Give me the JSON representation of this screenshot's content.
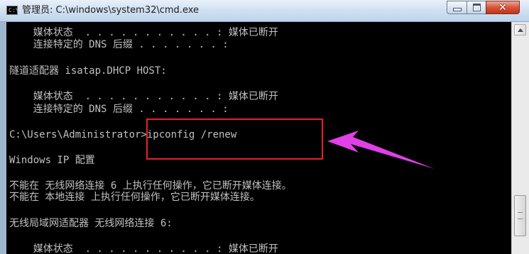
{
  "window": {
    "title": "管理员: C:\\windows\\system32\\cmd.exe",
    "icon_label": "C:\\"
  },
  "controls": {
    "minimize": "minimize",
    "maximize": "maximize",
    "close": "✕"
  },
  "console": {
    "lines": [
      "    媒体状态  . . . . . . . . . . . : 媒体已断开",
      "    连接特定的 DNS 后缀 . . . . . . . :",
      "",
      "隧道适配器 isatap.DHCP HOST:",
      "",
      "    媒体状态  . . . . . . . . . . . : 媒体已断开",
      "    连接特定的 DNS 后缀 . . . . . . . :",
      "",
      "C:\\Users\\Administrator>ipconfig /renew",
      "",
      "Windows IP 配置",
      "",
      "不能在 无线网络连接 6 上执行任何操作，它已断开媒体连接。",
      "不能在 本地连接 上执行任何操作，它已断开媒体连接。",
      "",
      "无线局域网适配器 无线网络连接 6:",
      "",
      "    媒体状态  . . . . . . . . . . . : 媒体已断开"
    ]
  },
  "annotation": {
    "box_color": "#e8202a",
    "arrow_color": "#e040e6"
  }
}
